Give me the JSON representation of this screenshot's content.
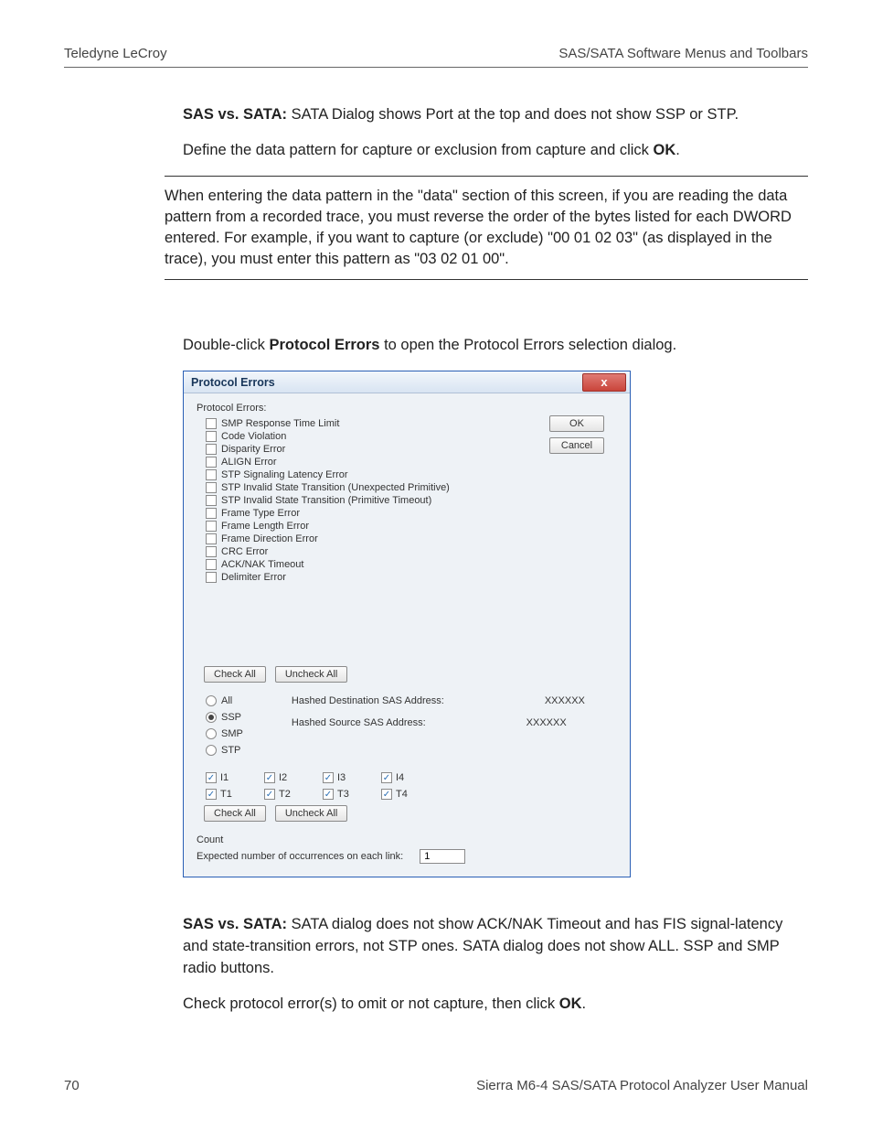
{
  "header": {
    "left": "Teledyne LeCroy",
    "right": "SAS/SATA Software Menus and Toolbars"
  },
  "para1_bold": "SAS vs. SATA:",
  "para1_rest": " SATA Dialog shows Port at the top and does not show SSP or STP.",
  "para2a": "Define the data pattern for capture or exclusion from capture and click ",
  "para2b": "OK",
  "para2c": ".",
  "note": "When entering the data pattern in the \"data\" section of this screen, if you are reading the data pattern from a recorded trace, you must reverse the order of the bytes listed for each DWORD entered. For example, if you want to capture (or exclude) \"00 01 02 03\" (as displayed in the trace), you must enter this pattern as \"03 02 01 00\".",
  "para3a": "Double-click ",
  "para3b": "Protocol Errors",
  "para3c": " to open the Protocol Errors selection dialog.",
  "dlg": {
    "title": "Protocol Errors",
    "close_x": "x",
    "ok": "OK",
    "cancel": "Cancel",
    "label": "Protocol Errors:",
    "errors": [
      "SMP Response Time Limit",
      "Code Violation",
      "Disparity Error",
      "ALIGN Error",
      "STP Signaling Latency Error",
      "STP Invalid State Transition (Unexpected Primitive)",
      "STP Invalid State Transition (Primitive Timeout)",
      "Frame Type Error",
      "Frame Length Error",
      "Frame Direction Error",
      "CRC Error",
      "ACK/NAK Timeout",
      "Delimiter Error"
    ],
    "check_all": "Check All",
    "uncheck_all": "Uncheck All",
    "radios": [
      "All",
      "SSP",
      "SMP",
      "STP"
    ],
    "hashed_dest_lbl": "Hashed Destination SAS Address:",
    "hashed_src_lbl": "Hashed Source SAS Address:",
    "hashed_val": "XXXXXX",
    "matrix_row1": [
      "I1",
      "I2",
      "I3",
      "I4"
    ],
    "matrix_row2": [
      "T1",
      "T2",
      "T3",
      "T4"
    ],
    "count_lbl": "Count",
    "count_line": "Expected number of occurrences on each link:",
    "count_val": "1"
  },
  "para4_bold": "SAS vs. SATA:",
  "para4_rest": " SATA dialog does not show ACK/NAK Timeout and has FIS signal-latency and state-transition errors, not STP ones. SATA dialog does not show ALL. SSP and SMP radio buttons.",
  "para5a": "Check protocol error(s) to omit or not capture, then click ",
  "para5b": "OK",
  "para5c": ".",
  "footer": {
    "page": "70",
    "title": "Sierra M6-4 SAS/SATA Protocol Analyzer User Manual"
  }
}
